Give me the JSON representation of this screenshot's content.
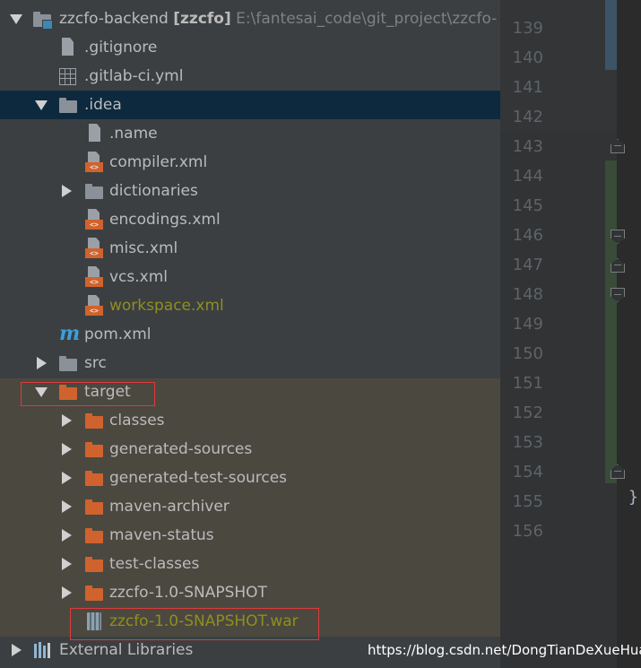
{
  "project_tree": {
    "root": {
      "name": "zzcfo-backend",
      "module": "[zzcfo]",
      "path": "E:\\fantesai_code\\git_project\\zzcfo-"
    },
    "gitignore": ".gitignore",
    "gitlab_ci": ".gitlab-ci.yml",
    "idea": {
      "name": ".idea",
      "children": {
        "name_file": ".name",
        "compiler": "compiler.xml",
        "dictionaries": "dictionaries",
        "encodings": "encodings.xml",
        "misc": "misc.xml",
        "vcs": "vcs.xml",
        "workspace": "workspace.xml"
      }
    },
    "pom": "pom.xml",
    "maven_icon_glyph": "m",
    "src": "src",
    "target": {
      "name": "target",
      "children": {
        "classes": "classes",
        "generated_sources": "generated-sources",
        "generated_test_sources": "generated-test-sources",
        "maven_archiver": "maven-archiver",
        "maven_status": "maven-status",
        "test_classes": "test-classes",
        "snapshot_dir": "zzcfo-1.0-SNAPSHOT",
        "war": "zzcfo-1.0-SNAPSHOT.war"
      }
    },
    "external_libraries": "External Libraries"
  },
  "gutter": {
    "line_numbers": [
      "139",
      "140",
      "141",
      "142",
      "143",
      "144",
      "145",
      "146",
      "147",
      "148",
      "149",
      "150",
      "151",
      "152",
      "153",
      "154",
      "155",
      "156"
    ]
  },
  "editor": {
    "closing_brace": "}"
  },
  "watermark": "https://blog.csdn.net/DongTianDeXueHua",
  "colors": {
    "panel_bg": "#3c3f41",
    "selected_row": "#0d293e",
    "excluded_zone": "#4b4840",
    "folder_orange": "#d0632d",
    "changed_file": "#8f8f1f",
    "highlight_box": "#e03a3a",
    "maven_blue": "#3d9fd9"
  }
}
